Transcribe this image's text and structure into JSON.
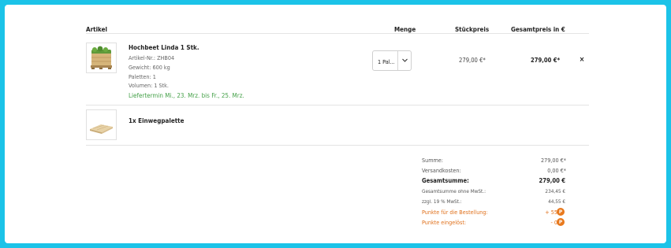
{
  "table": {
    "headers": {
      "article": "Artikel",
      "quantity": "Menge",
      "unit_price": "Stückpreis",
      "total_price": "Gesamtpreis in €"
    }
  },
  "items": [
    {
      "name": "Hochbeet Linda 1 Stk.",
      "article_no": "Artikel-Nr.: ZHB04",
      "weight": "Gewicht: 600 kg",
      "pallets": "Paletten: 1",
      "volume": "Volumen: 1 Stk.",
      "delivery": "Liefertermin Mi., 23. Mrz. bis Fr., 25. Mrz.",
      "quantity_selected": "1 Pal...",
      "unit_price": "279,00 €*",
      "total_price": "279,00 €*",
      "remove_label": "×"
    },
    {
      "name": "1x Einwegpalette"
    }
  ],
  "summary": {
    "sum_label": "Summe:",
    "sum_value": "279,00 €*",
    "shipping_label": "Versandkosten:",
    "shipping_value": "0,00 €*",
    "total_label": "Gesamtsumme:",
    "total_value": "279,00 €",
    "net_label": "Gesamtsumme ohne MwSt.:",
    "net_value": "234,45 €",
    "vat_label": "zzgl. 19 % MwSt.:",
    "vat_value": "44,55 €",
    "points_order_label": "Punkte für die Bestellung:",
    "points_order_value": "+ 55",
    "points_redeemed_label": "Punkte eingelöst:",
    "points_redeemed_value": "- 0",
    "points_badge": "P"
  },
  "colors": {
    "background": "#1bc3e8",
    "delivery_green": "#43a047",
    "points_orange": "#e0711c"
  }
}
